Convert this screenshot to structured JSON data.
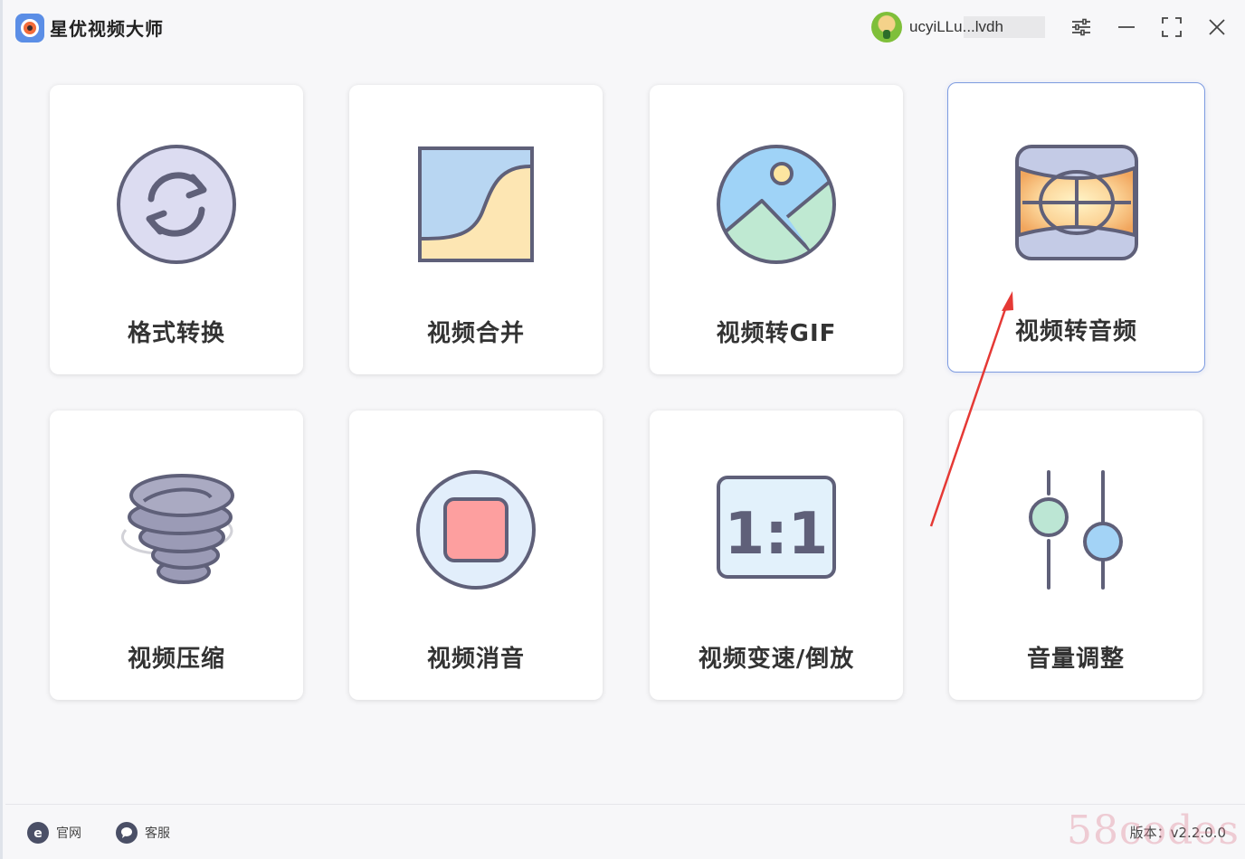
{
  "app": {
    "title": "星优视频大师",
    "user_name": "ucyiLLu...lvdh"
  },
  "window_controls": {
    "settings": "settings-icon",
    "minimize": "minimize-icon",
    "maximize": "maximize-icon",
    "close": "close-icon"
  },
  "tools": [
    {
      "label": "格式转换",
      "icon": "format-convert-icon"
    },
    {
      "label": "视频合并",
      "icon": "video-merge-icon"
    },
    {
      "label": "视频转GIF",
      "icon": "video-to-gif-icon"
    },
    {
      "label": "视频转音频",
      "icon": "video-to-audio-icon"
    },
    {
      "label": "视频压缩",
      "icon": "video-compress-icon"
    },
    {
      "label": "视频消音",
      "icon": "video-mute-icon"
    },
    {
      "label": "视频变速/倒放",
      "icon": "video-speed-icon"
    },
    {
      "label": "音量调整",
      "icon": "volume-adjust-icon"
    }
  ],
  "footer": {
    "website_label": "官网",
    "support_label": "客服",
    "version": "版本：v2.2.0.0"
  },
  "watermark": "58codes",
  "colors": {
    "accent_border": "#7d9be0",
    "arrow": "#e53935"
  }
}
